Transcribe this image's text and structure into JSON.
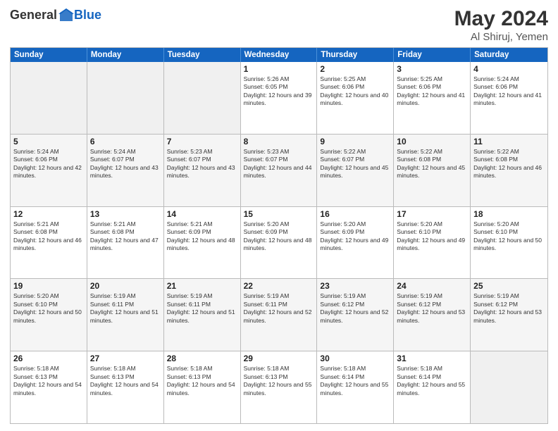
{
  "logo": {
    "general": "General",
    "blue": "Blue"
  },
  "title": {
    "month": "May 2024",
    "location": "Al Shiruj, Yemen"
  },
  "header_days": [
    "Sunday",
    "Monday",
    "Tuesday",
    "Wednesday",
    "Thursday",
    "Friday",
    "Saturday"
  ],
  "weeks": [
    [
      {
        "day": "",
        "empty": true
      },
      {
        "day": "",
        "empty": true
      },
      {
        "day": "",
        "empty": true
      },
      {
        "day": "1",
        "sunrise": "5:26 AM",
        "sunset": "6:05 PM",
        "daylight": "12 hours and 39 minutes."
      },
      {
        "day": "2",
        "sunrise": "5:25 AM",
        "sunset": "6:06 PM",
        "daylight": "12 hours and 40 minutes."
      },
      {
        "day": "3",
        "sunrise": "5:25 AM",
        "sunset": "6:06 PM",
        "daylight": "12 hours and 41 minutes."
      },
      {
        "day": "4",
        "sunrise": "5:24 AM",
        "sunset": "6:06 PM",
        "daylight": "12 hours and 41 minutes."
      }
    ],
    [
      {
        "day": "5",
        "sunrise": "5:24 AM",
        "sunset": "6:06 PM",
        "daylight": "12 hours and 42 minutes."
      },
      {
        "day": "6",
        "sunrise": "5:24 AM",
        "sunset": "6:07 PM",
        "daylight": "12 hours and 43 minutes."
      },
      {
        "day": "7",
        "sunrise": "5:23 AM",
        "sunset": "6:07 PM",
        "daylight": "12 hours and 43 minutes."
      },
      {
        "day": "8",
        "sunrise": "5:23 AM",
        "sunset": "6:07 PM",
        "daylight": "12 hours and 44 minutes."
      },
      {
        "day": "9",
        "sunrise": "5:22 AM",
        "sunset": "6:07 PM",
        "daylight": "12 hours and 45 minutes."
      },
      {
        "day": "10",
        "sunrise": "5:22 AM",
        "sunset": "6:08 PM",
        "daylight": "12 hours and 45 minutes."
      },
      {
        "day": "11",
        "sunrise": "5:22 AM",
        "sunset": "6:08 PM",
        "daylight": "12 hours and 46 minutes."
      }
    ],
    [
      {
        "day": "12",
        "sunrise": "5:21 AM",
        "sunset": "6:08 PM",
        "daylight": "12 hours and 46 minutes."
      },
      {
        "day": "13",
        "sunrise": "5:21 AM",
        "sunset": "6:08 PM",
        "daylight": "12 hours and 47 minutes."
      },
      {
        "day": "14",
        "sunrise": "5:21 AM",
        "sunset": "6:09 PM",
        "daylight": "12 hours and 48 minutes."
      },
      {
        "day": "15",
        "sunrise": "5:20 AM",
        "sunset": "6:09 PM",
        "daylight": "12 hours and 48 minutes."
      },
      {
        "day": "16",
        "sunrise": "5:20 AM",
        "sunset": "6:09 PM",
        "daylight": "12 hours and 49 minutes."
      },
      {
        "day": "17",
        "sunrise": "5:20 AM",
        "sunset": "6:10 PM",
        "daylight": "12 hours and 49 minutes."
      },
      {
        "day": "18",
        "sunrise": "5:20 AM",
        "sunset": "6:10 PM",
        "daylight": "12 hours and 50 minutes."
      }
    ],
    [
      {
        "day": "19",
        "sunrise": "5:20 AM",
        "sunset": "6:10 PM",
        "daylight": "12 hours and 50 minutes."
      },
      {
        "day": "20",
        "sunrise": "5:19 AM",
        "sunset": "6:11 PM",
        "daylight": "12 hours and 51 minutes."
      },
      {
        "day": "21",
        "sunrise": "5:19 AM",
        "sunset": "6:11 PM",
        "daylight": "12 hours and 51 minutes."
      },
      {
        "day": "22",
        "sunrise": "5:19 AM",
        "sunset": "6:11 PM",
        "daylight": "12 hours and 52 minutes."
      },
      {
        "day": "23",
        "sunrise": "5:19 AM",
        "sunset": "6:12 PM",
        "daylight": "12 hours and 52 minutes."
      },
      {
        "day": "24",
        "sunrise": "5:19 AM",
        "sunset": "6:12 PM",
        "daylight": "12 hours and 53 minutes."
      },
      {
        "day": "25",
        "sunrise": "5:19 AM",
        "sunset": "6:12 PM",
        "daylight": "12 hours and 53 minutes."
      }
    ],
    [
      {
        "day": "26",
        "sunrise": "5:18 AM",
        "sunset": "6:13 PM",
        "daylight": "12 hours and 54 minutes."
      },
      {
        "day": "27",
        "sunrise": "5:18 AM",
        "sunset": "6:13 PM",
        "daylight": "12 hours and 54 minutes."
      },
      {
        "day": "28",
        "sunrise": "5:18 AM",
        "sunset": "6:13 PM",
        "daylight": "12 hours and 54 minutes."
      },
      {
        "day": "29",
        "sunrise": "5:18 AM",
        "sunset": "6:13 PM",
        "daylight": "12 hours and 55 minutes."
      },
      {
        "day": "30",
        "sunrise": "5:18 AM",
        "sunset": "6:14 PM",
        "daylight": "12 hours and 55 minutes."
      },
      {
        "day": "31",
        "sunrise": "5:18 AM",
        "sunset": "6:14 PM",
        "daylight": "12 hours and 55 minutes."
      },
      {
        "day": "",
        "empty": true
      }
    ]
  ]
}
